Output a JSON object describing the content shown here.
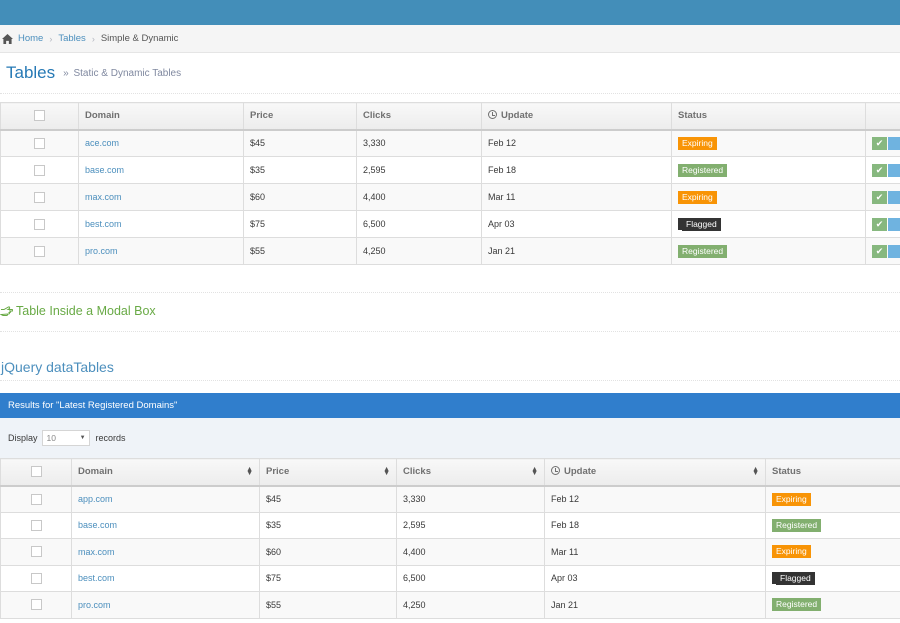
{
  "breadcrumb": {
    "home": "Home",
    "tables": "Tables",
    "current": "Simple & Dynamic"
  },
  "page_header": {
    "title": "Tables",
    "subtitle_prefix": "»",
    "subtitle": "Static & Dynamic Tables"
  },
  "table1": {
    "headers": {
      "domain": "Domain",
      "price": "Price",
      "clicks": "Clicks",
      "update": "Update",
      "status": "Status"
    },
    "rows": [
      {
        "domain": "ace.com",
        "price": "$45",
        "clicks": "3,330",
        "update": "Feb 12",
        "status": "Expiring"
      },
      {
        "domain": "base.com",
        "price": "$35",
        "clicks": "2,595",
        "update": "Feb 18",
        "status": "Registered"
      },
      {
        "domain": "max.com",
        "price": "$60",
        "clicks": "4,400",
        "update": "Mar 11",
        "status": "Expiring"
      },
      {
        "domain": "best.com",
        "price": "$75",
        "clicks": "6,500",
        "update": "Apr 03",
        "status": "Flagged"
      },
      {
        "domain": "pro.com",
        "price": "$55",
        "clicks": "4,250",
        "update": "Jan 21",
        "status": "Registered"
      }
    ]
  },
  "modal_section": {
    "title": "Table Inside a Modal Box",
    "icon": "hand-o-right-icon"
  },
  "datatables_section": {
    "title": "jQuery dataTables"
  },
  "results_header": "Results for \"Latest Registered Domains\"",
  "toolbar": {
    "display_label": "Display",
    "length_value": "10",
    "records_label": "records"
  },
  "table2": {
    "headers": {
      "domain": "Domain",
      "price": "Price",
      "clicks": "Clicks",
      "update": "Update",
      "status": "Status"
    },
    "rows": [
      {
        "domain": "app.com",
        "price": "$45",
        "clicks": "3,330",
        "update": "Feb 12",
        "status": "Expiring"
      },
      {
        "domain": "base.com",
        "price": "$35",
        "clicks": "2,595",
        "update": "Feb 18",
        "status": "Registered"
      },
      {
        "domain": "max.com",
        "price": "$60",
        "clicks": "4,400",
        "update": "Mar 11",
        "status": "Expiring"
      },
      {
        "domain": "best.com",
        "price": "$75",
        "clicks": "6,500",
        "update": "Apr 03",
        "status": "Flagged"
      },
      {
        "domain": "pro.com",
        "price": "$55",
        "clicks": "4,250",
        "update": "Jan 21",
        "status": "Registered"
      }
    ]
  },
  "colors": {
    "navbar": "#438eb9",
    "link": "#4c8fbd",
    "expiring": "#f89406",
    "registered": "#82af6f",
    "flagged": "#333333",
    "table_header": "#307ecc"
  }
}
